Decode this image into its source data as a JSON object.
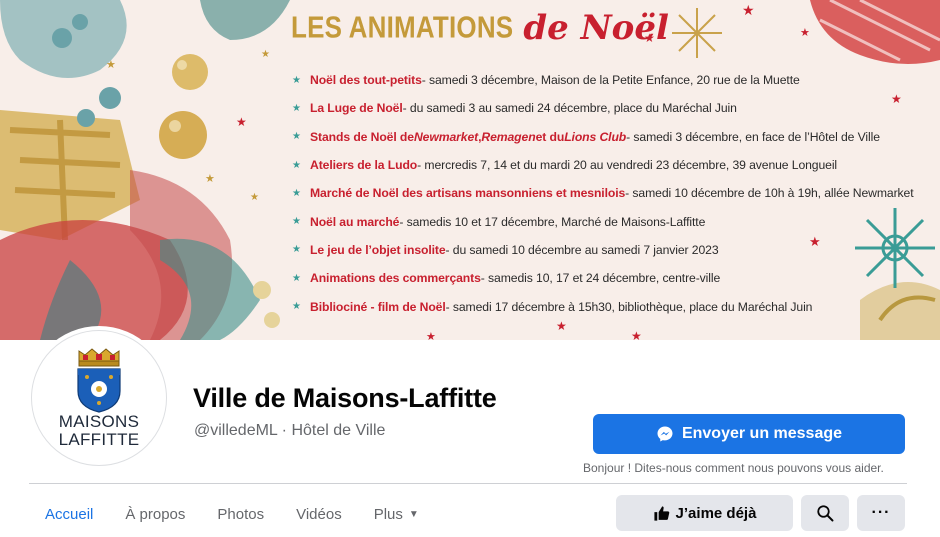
{
  "cover": {
    "heading_main": "LES ANIMATIONS",
    "heading_script": "de Noël",
    "events": [
      {
        "title": "Noël des tout-petits",
        "details": " - samedi 3 décembre, Maison de la Petite Enfance, 20 rue de la Muette"
      },
      {
        "title": "La Luge de Noël",
        "details": " - du samedi 3 au samedi 24 décembre, place du Maréchal Juin"
      },
      {
        "title": "Stands de Noël de ",
        "italic1": "Newmarket",
        "sep1": ", ",
        "italic2": "Remagen",
        "sep2": " et du ",
        "italic3": "Lions Club",
        "details": " - samedi 3 décembre, en face de l’Hôtel de Ville"
      },
      {
        "title": "Ateliers de la Ludo",
        "details": " - mercredis 7, 14 et du mardi 20 au vendredi 23 décembre, 39 avenue Longueil"
      },
      {
        "title": "Marché de Noël des artisans mansonniens et mesnilois",
        "details": " - samedi 10 décembre de 10h à 19h, allée Newmarket"
      },
      {
        "title": "Noël au marché",
        "details": " - samedis 10 et 17 décembre, Marché de Maisons-Laffitte"
      },
      {
        "title": "Le jeu de l’objet insolite",
        "details": " - du samedi 10 décembre au samedi 7 janvier 2023"
      },
      {
        "title": "Animations des commerçants",
        "details": " - samedis 10, 17 et 24 décembre, centre-ville"
      },
      {
        "title": "Biblіociné - film de Noël",
        "details": " - samedi 17 décembre à 15h30, bibliothèque, place du Maréchal Juin"
      }
    ],
    "star_glyph": "★"
  },
  "profile": {
    "logo_line1": "MAISONS",
    "logo_line2": "LAFFITTE",
    "name": "Ville de Maisons-Laffitte",
    "subtitle": "@villedeML · Hôtel de Ville"
  },
  "message": {
    "button_label": "Envoyer un message",
    "hint": "Bonjour ! Dites-nous comment nous pouvons vous aider."
  },
  "tabs": [
    {
      "label": "Accueil",
      "active": true
    },
    {
      "label": "À propos",
      "active": false
    },
    {
      "label": "Photos",
      "active": false
    },
    {
      "label": "Vidéos",
      "active": false
    },
    {
      "label": "Plus",
      "active": false
    }
  ],
  "actions": {
    "like_label": "J’aime déjà",
    "more_label": "···"
  },
  "icons": {
    "messenger": "messenger-icon",
    "thumbs_up": "thumbs-up-icon",
    "search": "search-icon",
    "more": "more-dots-icon",
    "caret": "caret-down-icon"
  },
  "colors": {
    "primary": "#1b74e4",
    "cover_red": "#c8202f",
    "cover_gold": "#c49a3a",
    "cover_teal": "#3a9c96",
    "muted_text": "#65676b"
  }
}
